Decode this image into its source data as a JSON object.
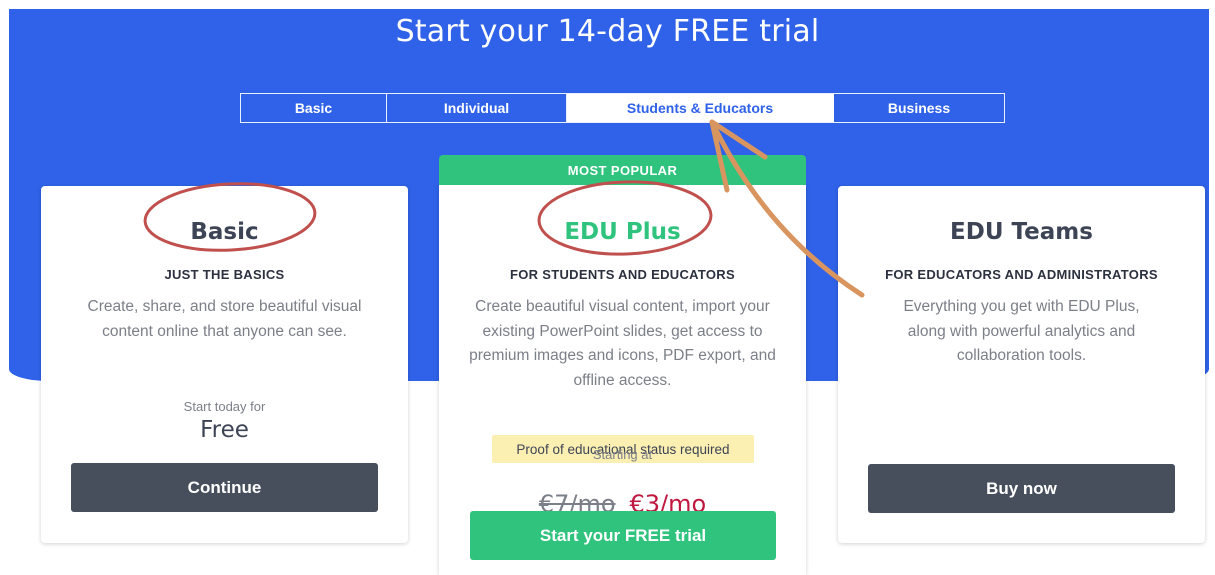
{
  "header": {
    "title": "Start your 14-day FREE trial"
  },
  "tabs": [
    {
      "label": "Basic",
      "active": false
    },
    {
      "label": "Individual",
      "active": false
    },
    {
      "label": "Students & Educators",
      "active": true
    },
    {
      "label": "Business",
      "active": false
    }
  ],
  "plans": {
    "basic": {
      "title": "Basic",
      "subtitle": "JUST THE BASICS",
      "description": "Create, share, and store beautiful visual content online that anyone can see.",
      "price_label": "Start today for",
      "price": "Free",
      "button": "Continue"
    },
    "edu_plus": {
      "banner": "MOST POPULAR",
      "title": "EDU Plus",
      "subtitle": "FOR STUDENTS AND EDUCATORS",
      "description": "Create beautiful visual content, import your existing PowerPoint slides, get access to premium images and icons, PDF export, and offline access.",
      "notice": "Proof of educational status required",
      "price_label": "Starting at",
      "old_price": "€7/mo",
      "new_price": "€3/mo",
      "button": "Start your FREE trial"
    },
    "edu_teams": {
      "title": "EDU Teams",
      "subtitle": "FOR EDUCATORS AND ADMINISTRATORS",
      "description": "Everything you get with EDU Plus, along with powerful analytics and collaboration tools.",
      "button": "Buy now"
    }
  },
  "colors": {
    "brand_blue": "#2f62e8",
    "accent_green": "#2fc37d",
    "dark_button": "#474e5c",
    "sale_red": "#c0173f",
    "annotation_circle": "#c0504d",
    "annotation_arrow": "#d9955f"
  }
}
